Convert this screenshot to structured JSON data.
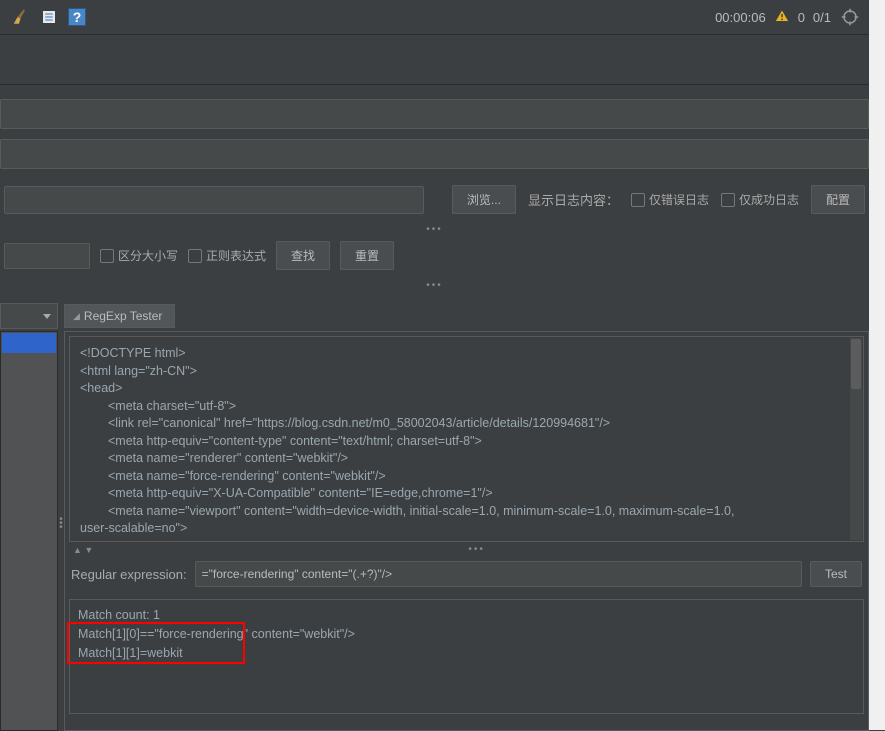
{
  "toolbar": {
    "timer": "00:00:06",
    "counter_zero": "0",
    "counter_ratio": "0/1"
  },
  "filter_bar": {
    "browse_btn": "浏览...",
    "log_content_label": "显示日志内容：",
    "only_error_log": "仅错误日志",
    "only_success_log": "仅成功日志",
    "config_btn": "配置"
  },
  "search_bar": {
    "case_sensitive": "区分大小写",
    "regex_mode": "正则表达式",
    "find_btn": "查找",
    "reset_btn": "重置"
  },
  "tabs": {
    "regexp_tester": "RegExp Tester"
  },
  "code": {
    "l1": "<!DOCTYPE html>",
    "l2": "<html lang=\"zh-CN\">",
    "l3": "<head>",
    "l4": "<meta charset=\"utf-8\">",
    "l5": "<link rel=\"canonical\" href=\"https://blog.csdn.net/m0_58002043/article/details/120994681\"/>",
    "l6": "<meta http-equiv=\"content-type\" content=\"text/html; charset=utf-8\">",
    "l7": "<meta name=\"renderer\" content=\"webkit\"/>",
    "l8": "<meta name=\"force-rendering\" content=\"webkit\"/>",
    "l9": "<meta http-equiv=\"X-UA-Compatible\" content=\"IE=edge,chrome=1\"/>",
    "l10": "<meta name=\"viewport\" content=\"width=device-width, initial-scale=1.0, minimum-scale=1.0, maximum-scale=1.0,",
    "l11": "user-scalable=no\">"
  },
  "regex": {
    "label": "Regular expression:",
    "value": "=\"force-rendering\" content=\"(.+?)\"/>",
    "test_btn": "Test"
  },
  "match": {
    "count": "Match count: 1",
    "m0": "Match[1][0]==\"force-rendering\" content=\"webkit\"/>",
    "m1": "Match[1][1]=webkit"
  }
}
